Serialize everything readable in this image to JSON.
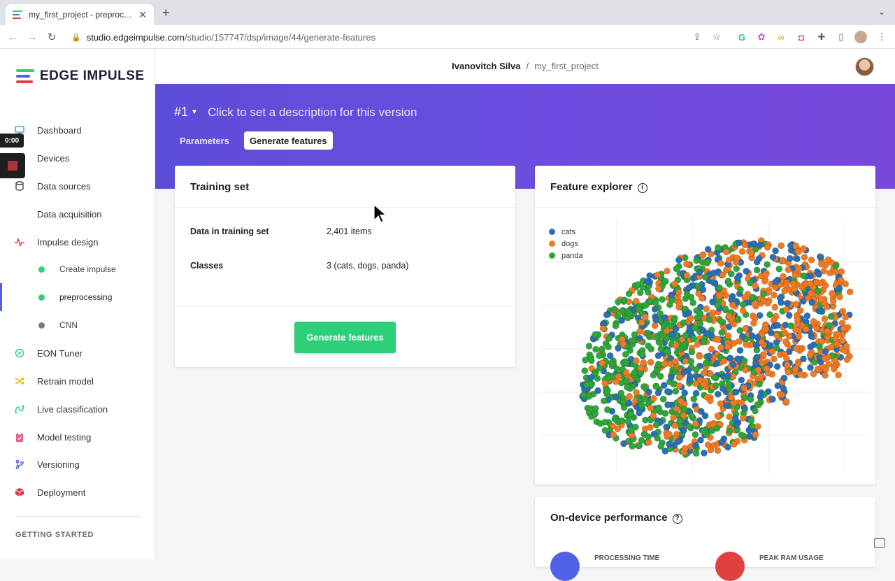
{
  "browser": {
    "tab_title": "my_first_project - preprocessing",
    "new_tab": "+",
    "url_domain": "studio.edgeimpulse.com",
    "url_path": "/studio/157747/dsp/image/44/generate-features"
  },
  "sidebar": {
    "logo_text": "EDGE IMPULSE",
    "items": [
      {
        "label": "Dashboard",
        "icon": "monitor-icon",
        "color": "#3fa9d8"
      },
      {
        "label": "Devices",
        "icon": "chip-icon",
        "color": "#5161e6"
      },
      {
        "label": "Data sources",
        "icon": "database-icon",
        "color": "#444"
      },
      {
        "label": "Data acquisition",
        "icon": "record-icon",
        "color": "#a7343f"
      },
      {
        "label": "Impulse design",
        "icon": "pulse-icon",
        "color": "#e2403f"
      },
      {
        "label": "Create impulse",
        "icon": "dot",
        "color": "#2ecf79"
      },
      {
        "label": "preprocessing",
        "icon": "dot",
        "color": "#2ecf79"
      },
      {
        "label": "CNN",
        "icon": "dot",
        "color": "#7a7a8a"
      },
      {
        "label": "EON Tuner",
        "icon": "compass-icon",
        "color": "#2ecf79"
      },
      {
        "label": "Retrain model",
        "icon": "shuffle-icon",
        "color": "#e8b213"
      },
      {
        "label": "Live classification",
        "icon": "live-icon",
        "color": "#2ecf79"
      },
      {
        "label": "Model testing",
        "icon": "clipboard-icon",
        "color": "#e85b8a"
      },
      {
        "label": "Versioning",
        "icon": "branch-icon",
        "color": "#5161e6"
      },
      {
        "label": "Deployment",
        "icon": "box-icon",
        "color": "#d6354c"
      }
    ],
    "section_title": "GETTING STARTED",
    "video_time": "0:00"
  },
  "header": {
    "user": "Ivanovitch Silva",
    "separator": "/",
    "project": "my_first_project"
  },
  "hero": {
    "version": "#1",
    "description": "Click to set a description for this version",
    "tabs": [
      "Parameters",
      "Generate features"
    ]
  },
  "training_set": {
    "title": "Training set",
    "rows": [
      {
        "label": "Data in training set",
        "value": "2,401 items"
      },
      {
        "label": "Classes",
        "value": "3 (cats, dogs, panda)"
      }
    ],
    "button": "Generate features"
  },
  "feature_explorer": {
    "title": "Feature explorer",
    "info_icon": "i"
  },
  "performance": {
    "title": "On-device performance",
    "help_icon": "?",
    "metric_1": "PROCESSING TIME",
    "metric_2": "PEAK RAM USAGE"
  },
  "chart_data": {
    "type": "scatter",
    "series": [
      {
        "name": "cats",
        "color": "#2a6fb5"
      },
      {
        "name": "dogs",
        "color": "#f07a23"
      },
      {
        "name": "panda",
        "color": "#2ea63a"
      }
    ],
    "grid": true,
    "legend": "top-left"
  }
}
